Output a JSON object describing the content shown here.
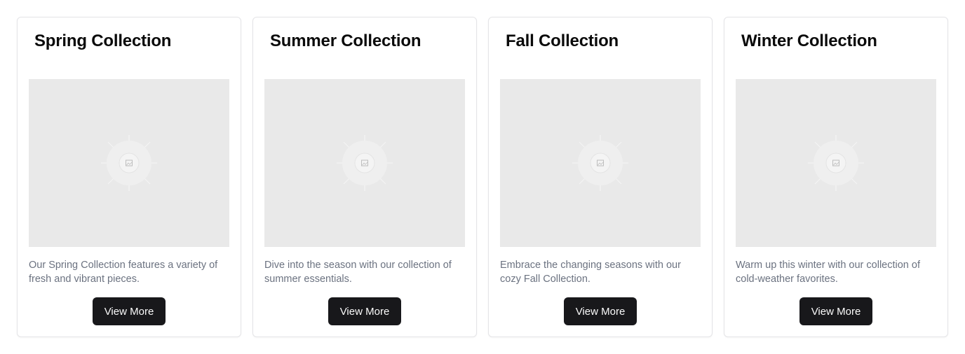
{
  "cards": [
    {
      "title": "Spring Collection",
      "description": "Our Spring Collection features a variety of fresh and vibrant pieces.",
      "button_label": "View More",
      "image_icon": "image-placeholder-icon"
    },
    {
      "title": "Summer Collection",
      "description": "Dive into the season with our collection of summer essentials.",
      "button_label": "View More",
      "image_icon": "image-placeholder-icon"
    },
    {
      "title": "Fall Collection",
      "description": "Embrace the changing seasons with our cozy Fall Collection.",
      "button_label": "View More",
      "image_icon": "image-placeholder-icon"
    },
    {
      "title": "Winter Collection",
      "description": "Warm up this winter with our collection of cold-weather favorites.",
      "button_label": "View More",
      "image_icon": "image-placeholder-icon"
    }
  ],
  "colors": {
    "button_background": "#18181b",
    "button_text": "#fafafa",
    "title_text": "#0a0a0a",
    "description_text": "#6b7280",
    "image_placeholder": "#e9e9e9",
    "card_border": "#e4e4e7"
  }
}
